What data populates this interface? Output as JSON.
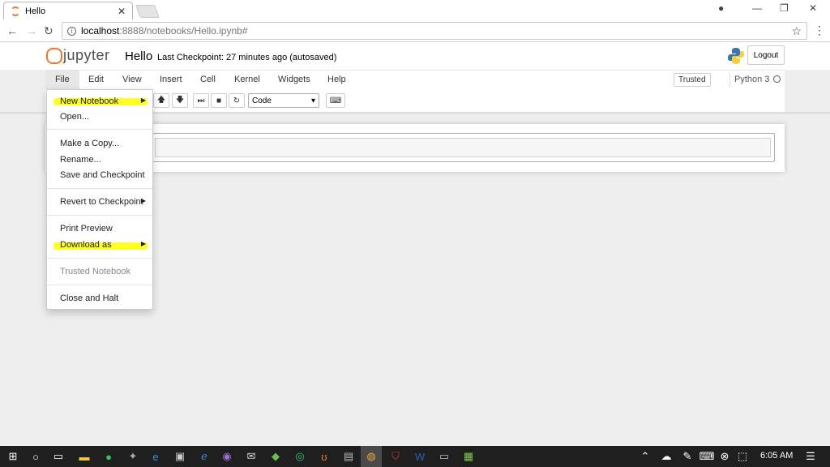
{
  "browser": {
    "tab_title": "Hello",
    "url_host": "localhost",
    "url_path": ":8888/notebooks/Hello.ipynb#"
  },
  "header": {
    "logo_text": "jupyter",
    "notebook_name": "Hello",
    "checkpoint_text": "Last Checkpoint: 27 minutes ago (autosaved)",
    "logout_label": "Logout"
  },
  "menubar": {
    "items": [
      "File",
      "Edit",
      "View",
      "Insert",
      "Cell",
      "Kernel",
      "Widgets",
      "Help"
    ],
    "trusted_label": "Trusted",
    "kernel_name": "Python 3"
  },
  "toolbar": {
    "cell_type": "Code"
  },
  "file_menu": {
    "items": [
      "New Notebook",
      "Open...",
      "Make a Copy...",
      "Rename...",
      "Save and Checkpoint",
      "Revert to Checkpoint",
      "Print Preview",
      "Download as",
      "Trusted Notebook",
      "Close and Halt"
    ]
  },
  "highlight_color": "#ffff00",
  "taskbar": {
    "clock": "6:05 AM"
  }
}
